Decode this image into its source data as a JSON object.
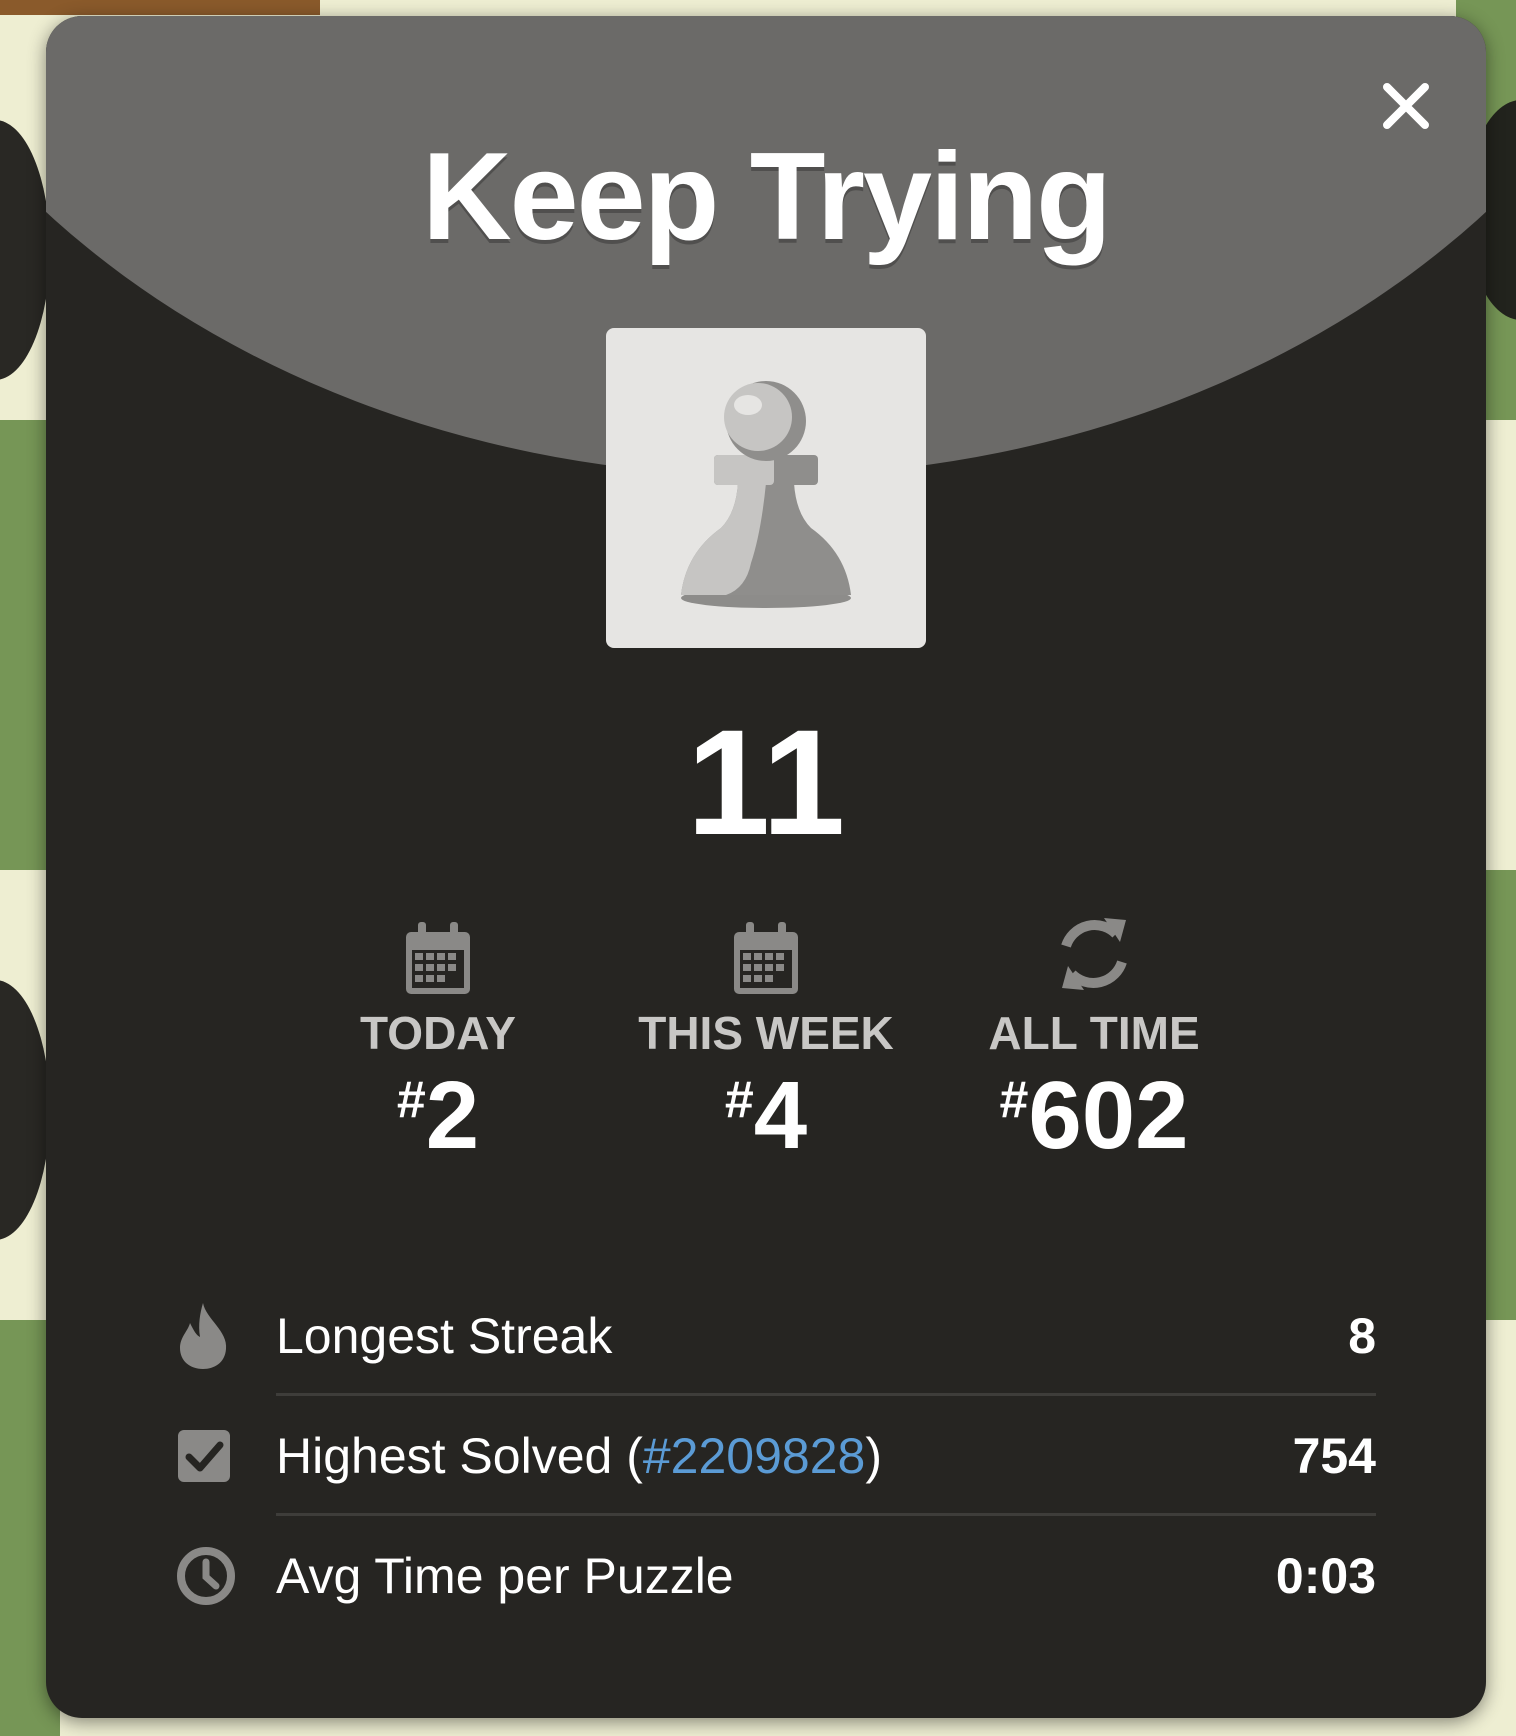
{
  "modal": {
    "title": "Keep Trying",
    "score": "11",
    "close_label": "×"
  },
  "ranks": [
    {
      "label": "TODAY",
      "hash": "#",
      "value": "2",
      "icon": "calendar-icon"
    },
    {
      "label": "THIS WEEK",
      "hash": "#",
      "value": "4",
      "icon": "calendar-icon"
    },
    {
      "label": "ALL TIME",
      "hash": "#",
      "value": "602",
      "icon": "refresh-icon"
    }
  ],
  "stats": {
    "streak": {
      "label": "Longest Streak",
      "value": "8",
      "icon": "flame-icon"
    },
    "highest": {
      "label_prefix": "Highest Solved (",
      "link": "#2209828",
      "label_suffix": ")",
      "value": "754",
      "icon": "checkbox-icon"
    },
    "avg": {
      "label": "Avg Time per Puzzle",
      "value": "0:03",
      "icon": "clock-icon"
    }
  },
  "colors": {
    "modal_bg": "#262522",
    "header_bg": "#6b6a68",
    "link": "#5b9bd5",
    "board_light": "#eeeed2",
    "board_dark": "#769656"
  }
}
